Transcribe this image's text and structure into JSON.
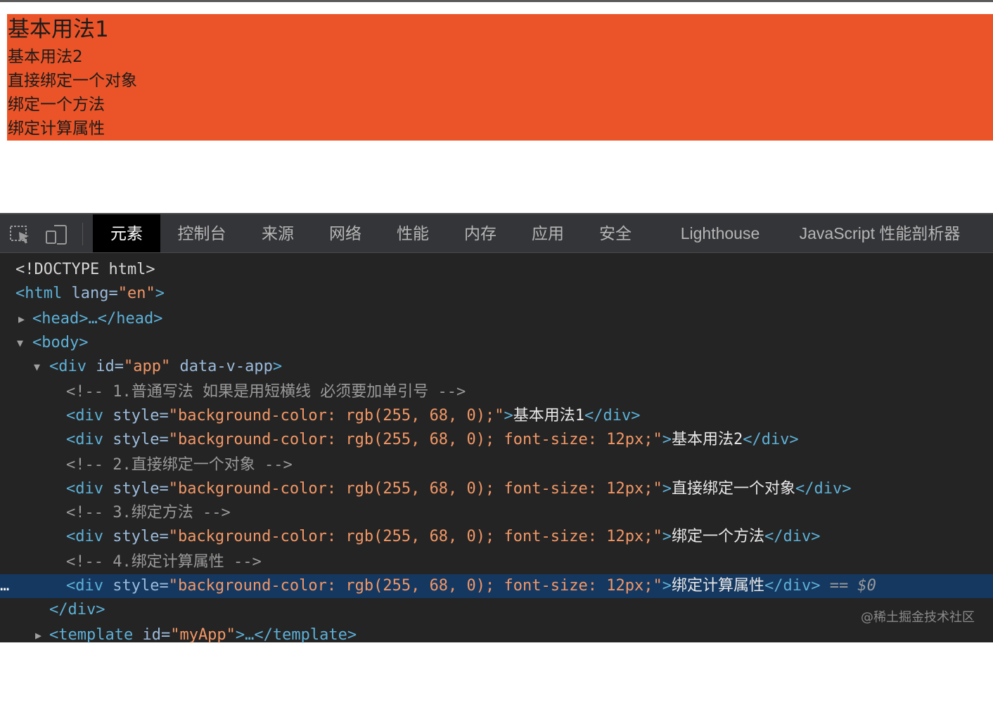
{
  "preview": {
    "bg_color": "#EA5428",
    "lines": [
      "基本用法1",
      "基本用法2",
      "直接绑定一个对象",
      "绑定一个方法",
      "绑定计算属性"
    ]
  },
  "devtools": {
    "tabs": [
      "元素",
      "控制台",
      "来源",
      "网络",
      "性能",
      "内存",
      "应用",
      "安全",
      "Lighthouse",
      "JavaScript 性能剖析器"
    ],
    "active_tab": "元素",
    "tool_icons": [
      "inspect-element-icon",
      "device-toolbar-icon"
    ],
    "dom": {
      "doctype": "<!DOCTYPE html>",
      "html_open": "<html",
      "html_attr": " lang=",
      "html_val": "\"en\"",
      "html_close": ">",
      "head": "<head>…</head>",
      "body": "<body>",
      "div_app_open": "<div",
      "div_app_attr1": " id=",
      "div_app_val1": "\"app\"",
      "div_app_attr2": " data-v-app",
      "div_app_close": ">",
      "comment1": "<!-- 1.普通写法 如果是用短横线 必须要加单引号 -->",
      "style_attr": " style=",
      "div_open": "<div",
      "div_end": "</div>",
      "gt": ">",
      "row1_val": "\"background-color: rgb(255, 68, 0);\"",
      "row1_text": "基本用法1",
      "style_full_val": "\"background-color: rgb(255, 68, 0); font-size: 12px;\"",
      "row2_text": "基本用法2",
      "comment2": "<!-- 2.直接绑定一个对象 -->",
      "row3_text": "直接绑定一个对象",
      "comment3": "<!-- 3.绑定方法 -->",
      "row4_text": "绑定一个方法",
      "comment4": "<!-- 4.绑定计算属性 -->",
      "row5_text": "绑定计算属性",
      "selected_ref": " == $0",
      "close_div": "</div>",
      "template_open": "<template",
      "template_attr": " id=",
      "template_val": "\"myApp\"",
      "template_rest": ">…</template>",
      "row_ellipsis": "…"
    }
  },
  "watermark": "@稀土掘金技术社区",
  "colors": {
    "tag": "#5DB0D7",
    "attr": "#9BBBDC",
    "value": "#F29766",
    "selected_row": "#153860",
    "devtools_bg": "#242424"
  }
}
